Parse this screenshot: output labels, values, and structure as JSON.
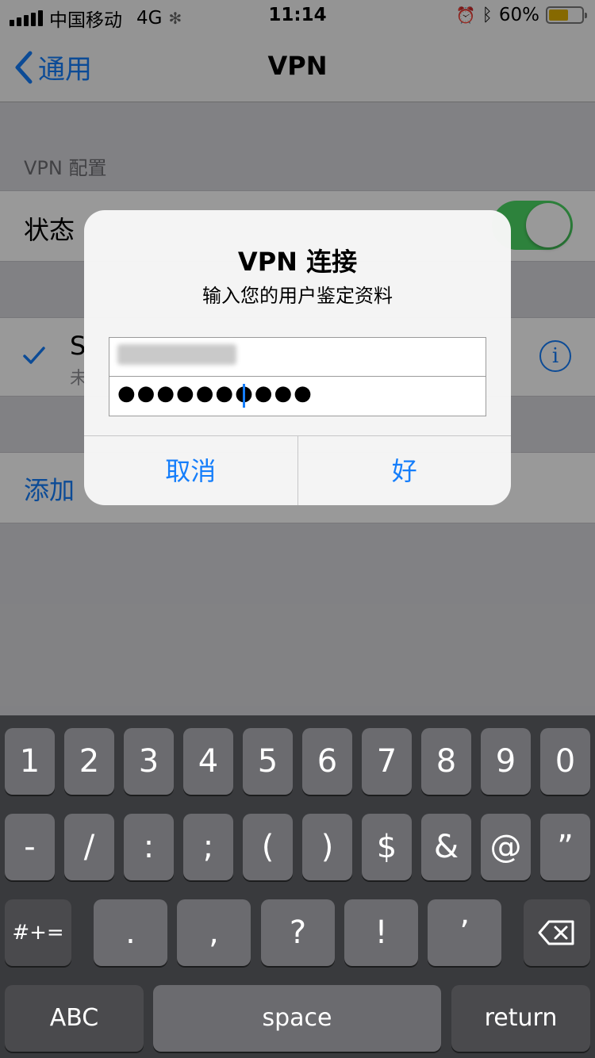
{
  "status_bar": {
    "carrier": "中国移动",
    "network": "4G",
    "time": "11:14",
    "battery_percent": "60%",
    "battery_level": 0.6
  },
  "nav": {
    "back_label": "通用",
    "title": "VPN"
  },
  "settings": {
    "section_header": "VPN 配置",
    "status_label": "状态",
    "status_on": true,
    "vpn_name_partial": "S",
    "vpn_sub_partial": "未",
    "add_label": "添加"
  },
  "alert": {
    "title": "VPN 连接",
    "message": "输入您的用户鉴定资料",
    "password_mask": "●●●●●●●●●●",
    "cancel_label": "取消",
    "ok_label": "好"
  },
  "keyboard": {
    "row1": [
      "1",
      "2",
      "3",
      "4",
      "5",
      "6",
      "7",
      "8",
      "9",
      "0"
    ],
    "row2": [
      "-",
      "/",
      ":",
      ";",
      "(",
      ")",
      "$",
      "&",
      "@",
      "”"
    ],
    "row3": [
      ".",
      ",",
      "?",
      "!",
      "’"
    ],
    "more_symbols": "#+=",
    "abc": "ABC",
    "space": "space",
    "return": "return"
  },
  "colors": {
    "accent": "#157efb",
    "toggle_on": "#4cd964",
    "battery": "#e0b000"
  }
}
